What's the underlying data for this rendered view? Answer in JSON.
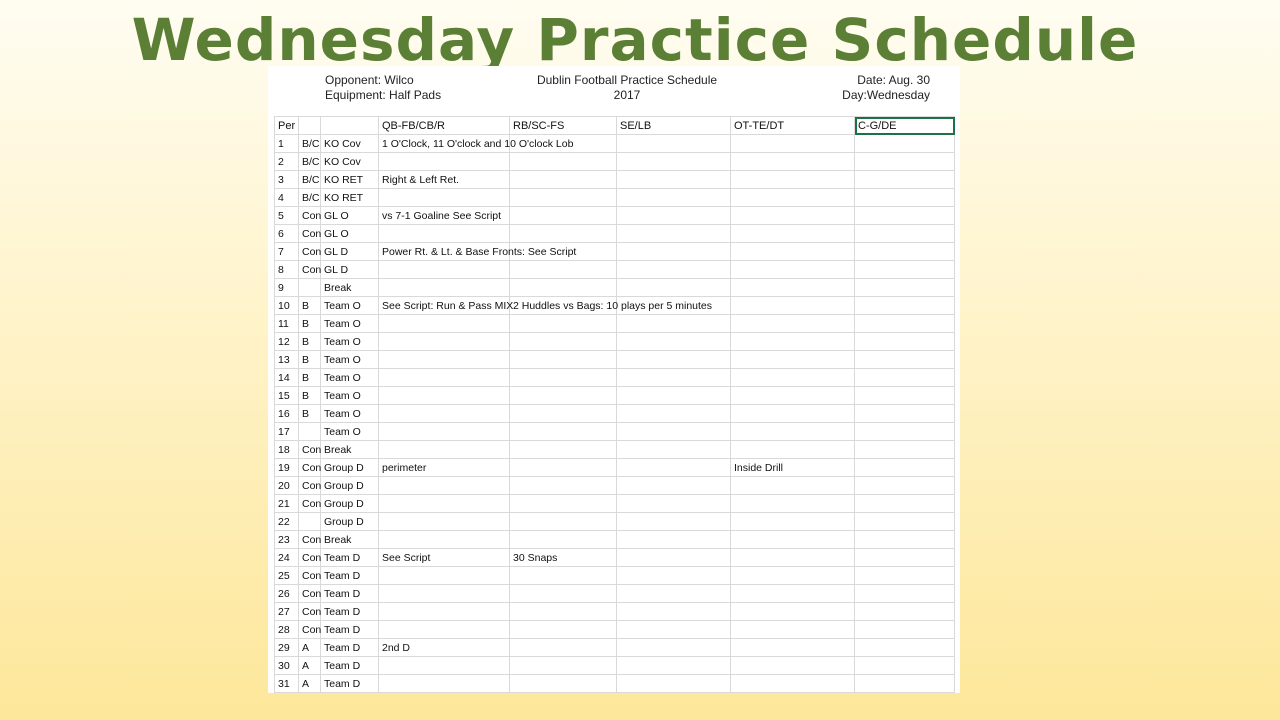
{
  "slide_title": "Wednesday Practice Schedule",
  "sheet": {
    "opponent": "Opponent: Wilco",
    "equipment": "Equipment: Half Pads",
    "title": "Dublin Football Practice Schedule",
    "year": "2017",
    "date": "Date: Aug. 30",
    "day": "Day:Wednesday"
  },
  "columns": [
    "Per",
    "",
    "",
    "QB-FB/CB/R",
    "RB/SC-FS",
    "SE/LB",
    "OT-TE/DT",
    "C-G/DE"
  ],
  "rows": [
    {
      "per": "1",
      "grp": "B/C",
      "act": "KO Cov",
      "c1": "1 O'Clock, 11 O'clock and 10 O'clock Lob",
      "c2": "",
      "c3": "",
      "c4": "",
      "c5": ""
    },
    {
      "per": "2",
      "grp": "B/C",
      "act": "KO Cov",
      "c1": "",
      "c2": "",
      "c3": "",
      "c4": "",
      "c5": ""
    },
    {
      "per": "3",
      "grp": "B/C",
      "act": "KO RET",
      "c1": "Right & Left Ret.",
      "c2": "",
      "c3": "",
      "c4": "",
      "c5": ""
    },
    {
      "per": "4",
      "grp": "B/C",
      "act": "KO RET",
      "c1": "",
      "c2": "",
      "c3": "",
      "c4": "",
      "c5": ""
    },
    {
      "per": "5",
      "grp": "Con",
      "act": "GL O",
      "c1": "vs 7-1 Goaline  See Script",
      "c2": "",
      "c3": "",
      "c4": "",
      "c5": ""
    },
    {
      "per": "6",
      "grp": "Con",
      "act": "GL O",
      "c1": "",
      "c2": "",
      "c3": "",
      "c4": "",
      "c5": ""
    },
    {
      "per": "7",
      "grp": "Con",
      "act": "GL D",
      "c1": "Power Rt. & Lt. & Base Fronts:  See Script",
      "c2": "",
      "c3": "",
      "c4": "",
      "c5": ""
    },
    {
      "per": "8",
      "grp": "Con",
      "act": "GL D",
      "c1": "",
      "c2": "",
      "c3": "",
      "c4": "",
      "c5": ""
    },
    {
      "per": "9",
      "grp": "",
      "act": "Break",
      "brk": true,
      "c1": "",
      "c2": "",
      "c3": "",
      "c4": "",
      "c5": ""
    },
    {
      "per": "10",
      "grp": "B",
      "act": "Team O",
      "c1": "See Script: Run & Pass MIX",
      "c2": "2 Huddles vs Bags:  10 plays per 5 minutes",
      "c3": "",
      "c4": "",
      "c5": ""
    },
    {
      "per": "11",
      "grp": "B",
      "act": "Team O",
      "c1": "",
      "c2": "",
      "c3": "",
      "c4": "",
      "c5": ""
    },
    {
      "per": "12",
      "grp": "B",
      "act": "Team O",
      "c1": "",
      "c2": "",
      "c3": "",
      "c4": "",
      "c5": ""
    },
    {
      "per": "13",
      "grp": "B",
      "act": "Team O",
      "c1": "",
      "c2": "",
      "c3": "",
      "c4": "",
      "c5": ""
    },
    {
      "per": "14",
      "grp": "B",
      "act": "Team O",
      "c1": "",
      "c2": "",
      "c3": "",
      "c4": "",
      "c5": ""
    },
    {
      "per": "15",
      "grp": "B",
      "act": "Team O",
      "c1": "",
      "c2": "",
      "c3": "",
      "c4": "",
      "c5": ""
    },
    {
      "per": "16",
      "grp": "B",
      "act": "Team O",
      "c1": "",
      "c2": "",
      "c3": "",
      "c4": "",
      "c5": ""
    },
    {
      "per": "17",
      "grp": "",
      "act": "Team O",
      "c1": "",
      "c2": "",
      "c3": "",
      "c4": "",
      "c5": ""
    },
    {
      "per": "18",
      "grp": "Con",
      "act": "Break",
      "brk": true,
      "c1": "",
      "c2": "",
      "c3": "",
      "c4": "",
      "c5": ""
    },
    {
      "per": "19",
      "grp": "Con",
      "act": "Group D",
      "c1": "perimeter",
      "c2": "",
      "c3": "",
      "c4": "Inside Drill",
      "c5": ""
    },
    {
      "per": "20",
      "grp": "Con",
      "act": "Group D",
      "c1": "",
      "c2": "",
      "c3": "",
      "c4": "",
      "c5": ""
    },
    {
      "per": "21",
      "grp": "Con",
      "act": "Group D",
      "c1": "",
      "c2": "",
      "c3": "",
      "c4": "",
      "c5": ""
    },
    {
      "per": "22",
      "grp": "",
      "act": "Group D",
      "c1": "",
      "c2": "",
      "c3": "",
      "c4": "",
      "c5": ""
    },
    {
      "per": "23",
      "grp": "Con",
      "act": "Break",
      "brk": true,
      "c1": "",
      "c2": "",
      "c3": "",
      "c4": "",
      "c5": ""
    },
    {
      "per": "24",
      "grp": "Con",
      "act": "Team D",
      "c1": "See Script",
      "c2": "30 Snaps",
      "c3": "",
      "c4": "",
      "c5": ""
    },
    {
      "per": "25",
      "grp": "Con",
      "act": "Team D",
      "c1": "",
      "c2": "",
      "c3": "",
      "c4": "",
      "c5": ""
    },
    {
      "per": "26",
      "grp": "Con",
      "act": "Team D",
      "c1": "",
      "c2": "",
      "c3": "",
      "c4": "",
      "c5": ""
    },
    {
      "per": "27",
      "grp": "Con",
      "act": "Team D",
      "c1": "",
      "c2": "",
      "c3": "",
      "c4": "",
      "c5": ""
    },
    {
      "per": "28",
      "grp": "Con",
      "act": "Team D",
      "c1": "",
      "c2": "",
      "c3": "",
      "c4": "",
      "c5": ""
    },
    {
      "per": "29",
      "grp": "A",
      "act": "Team D",
      "c1": "2nd D",
      "c2": "",
      "c3": "",
      "c4": "",
      "c5": ""
    },
    {
      "per": "30",
      "grp": "A",
      "act": "Team D",
      "c1": "",
      "c2": "",
      "c3": "",
      "c4": "",
      "c5": ""
    },
    {
      "per": "31",
      "grp": "A",
      "act": "Team D",
      "c1": "",
      "c2": "",
      "c3": "",
      "c4": "",
      "c5": ""
    }
  ]
}
